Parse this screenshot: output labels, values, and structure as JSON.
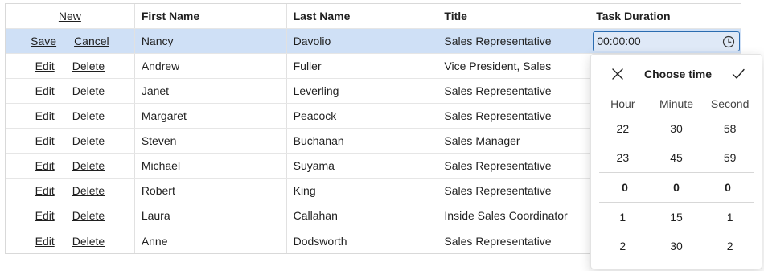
{
  "header": {
    "new_label": "New",
    "columns": [
      "First Name",
      "Last Name",
      "Title",
      "Task Duration"
    ]
  },
  "edit_row": {
    "save_label": "Save",
    "cancel_label": "Cancel",
    "first": "Nancy",
    "last": "Davolio",
    "title": "Sales Representative",
    "duration": "00:00:00"
  },
  "rows": [
    {
      "edit": "Edit",
      "delete": "Delete",
      "first": "Andrew",
      "last": "Fuller",
      "title": "Vice President, Sales"
    },
    {
      "edit": "Edit",
      "delete": "Delete",
      "first": "Janet",
      "last": "Leverling",
      "title": "Sales Representative"
    },
    {
      "edit": "Edit",
      "delete": "Delete",
      "first": "Margaret",
      "last": "Peacock",
      "title": "Sales Representative"
    },
    {
      "edit": "Edit",
      "delete": "Delete",
      "first": "Steven",
      "last": "Buchanan",
      "title": "Sales Manager"
    },
    {
      "edit": "Edit",
      "delete": "Delete",
      "first": "Michael",
      "last": "Suyama",
      "title": "Sales Representative"
    },
    {
      "edit": "Edit",
      "delete": "Delete",
      "first": "Robert",
      "last": "King",
      "title": "Sales Representative"
    },
    {
      "edit": "Edit",
      "delete": "Delete",
      "first": "Laura",
      "last": "Callahan",
      "title": "Inside Sales Coordinator"
    },
    {
      "edit": "Edit",
      "delete": "Delete",
      "first": "Anne",
      "last": "Dodsworth",
      "title": "Sales Representative"
    }
  ],
  "time_picker": {
    "title": "Choose time",
    "columns": [
      "Hour",
      "Minute",
      "Second"
    ],
    "rows": [
      [
        "22",
        "30",
        "58"
      ],
      [
        "23",
        "45",
        "59"
      ],
      [
        "0",
        "0",
        "0"
      ],
      [
        "1",
        "15",
        "1"
      ],
      [
        "2",
        "30",
        "2"
      ]
    ],
    "selected_row": 2,
    "icons": {
      "dismiss": "close-icon",
      "accept": "checkmark-icon",
      "clock": "clock-icon"
    }
  }
}
